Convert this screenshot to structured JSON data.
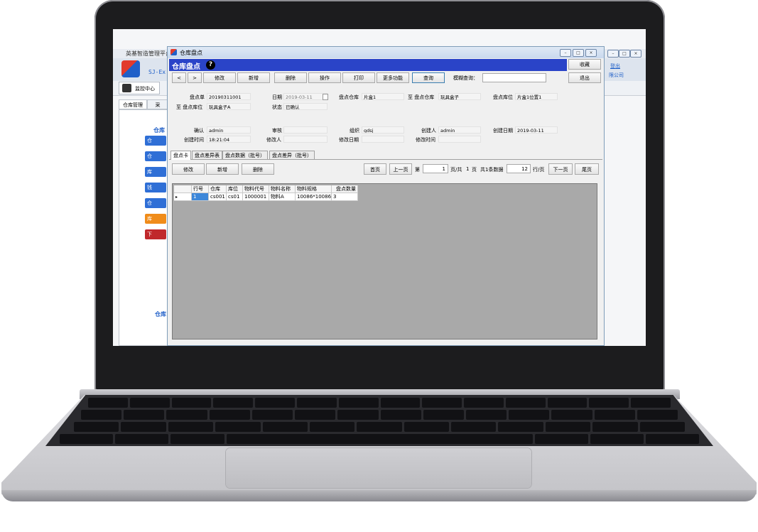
{
  "background_app": {
    "title": "英基智造管理平台",
    "brand_code": "SJ-Ex",
    "top_tab": "监控中心",
    "left_tabs": [
      "仓库管理",
      "采"
    ],
    "side_heading": "仓库",
    "side_heading_bottom": "仓库",
    "side_buttons": [
      {
        "label": "仓",
        "color": "#2f6fd6"
      },
      {
        "label": "仓",
        "color": "#2f6fd6"
      },
      {
        "label": "库",
        "color": "#2f6fd6"
      },
      {
        "label": "钱",
        "color": "#2f6fd6"
      },
      {
        "label": "仓",
        "color": "#2f6fd6"
      },
      {
        "label": "库",
        "color": "#f08c1a"
      },
      {
        "label": "下",
        "color": "#c0282b"
      }
    ],
    "right_links": [
      "登出",
      "限公司"
    ]
  },
  "window": {
    "title": "仓库盘点",
    "header": "仓库盘点",
    "help_icon": "question-icon",
    "right_buttons": [
      "收藏",
      "退出"
    ],
    "toolbar": [
      "<",
      ">",
      "修改",
      "新增",
      "删除",
      "操作",
      "打印",
      "更多功能",
      "查询"
    ],
    "search_label": "模糊查询：",
    "search_value": ""
  },
  "form": {
    "row1": [
      {
        "label": "盘点单",
        "value": "20190311001"
      },
      {
        "label": "日期",
        "value": "2019-03-11"
      },
      {
        "label": "盘点仓库",
        "value": "片盒1"
      },
      {
        "label": "至 盘点仓库",
        "value": "玩具盒子"
      },
      {
        "label": "盘点库位",
        "value": "片盒1位置1"
      }
    ],
    "row2": [
      {
        "label": "至 盘点库位",
        "value": "玩具盒子A"
      },
      {
        "label": "状态",
        "value": "已确认"
      }
    ],
    "row3": [
      {
        "label": "确认",
        "value": "admin"
      },
      {
        "label": "审核",
        "value": ""
      },
      {
        "label": "组织",
        "value": "gdsj"
      },
      {
        "label": "创建人",
        "value": "admin"
      },
      {
        "label": "创建日期",
        "value": "2019-03-11"
      }
    ],
    "row4": [
      {
        "label": "创建时间",
        "value": "18:21:04"
      },
      {
        "label": "修改人",
        "value": ""
      },
      {
        "label": "修改日期",
        "value": ""
      },
      {
        "label": "修改时间",
        "value": ""
      }
    ]
  },
  "tabs": [
    "盘点卡",
    "盘点差异表",
    "盘点数据（批号）",
    "盘点差异（批号）"
  ],
  "sub_toolbar": [
    "修改",
    "新增",
    "删除"
  ],
  "pager": {
    "first": "首页",
    "prev": "上一页",
    "page_prefix": "第",
    "page_value": "1",
    "page_suffix": "页/共",
    "total_pages": "1",
    "total_suffix": "页",
    "total_records": "共1条数据",
    "rows_per_page": "12",
    "rows_suffix": "行/页",
    "next": "下一页",
    "last": "尾页"
  },
  "table": {
    "columns": [
      "行号",
      "仓库",
      "库位",
      "物料代号",
      "物料名称",
      "物料规格",
      "盘点数量"
    ],
    "rows": [
      [
        "1",
        "cs001",
        "cs01",
        "1000001",
        "物料A",
        "10086*10086",
        "3"
      ]
    ]
  }
}
